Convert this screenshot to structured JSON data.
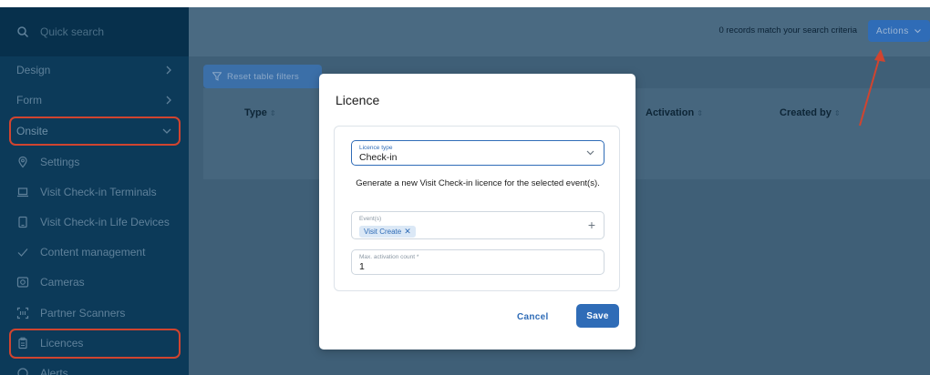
{
  "sidebar": {
    "search_placeholder": "Quick search",
    "items": [
      {
        "label": "Design"
      },
      {
        "label": "Form"
      },
      {
        "label": "Onsite"
      },
      {
        "label": "Settings"
      },
      {
        "label": "Visit Check-in Terminals"
      },
      {
        "label": "Visit Check-in Life Devices"
      },
      {
        "label": "Content management"
      },
      {
        "label": "Cameras"
      },
      {
        "label": "Partner Scanners"
      },
      {
        "label": "Licences"
      },
      {
        "label": "Alerts"
      }
    ]
  },
  "topbar": {
    "records_text": "0 records match your search criteria",
    "actions_label": "Actions"
  },
  "table": {
    "reset_label": "Reset table filters",
    "columns": [
      "Type",
      "Activation",
      "Created by"
    ]
  },
  "modal": {
    "title": "Licence",
    "licence_type": {
      "label": "Licence type",
      "value": "Check-in"
    },
    "description": "Generate a new Visit Check-in licence for the selected event(s).",
    "events": {
      "label": "Event(s)",
      "chip": "Visit Create"
    },
    "max_activation": {
      "label": "Max. activation count *",
      "value": "1"
    },
    "cancel_label": "Cancel",
    "save_label": "Save"
  },
  "colors": {
    "sidebar_bg": "#0c3a59",
    "accent_blue": "#2f6cb7",
    "highlight_red": "#d1442f"
  }
}
